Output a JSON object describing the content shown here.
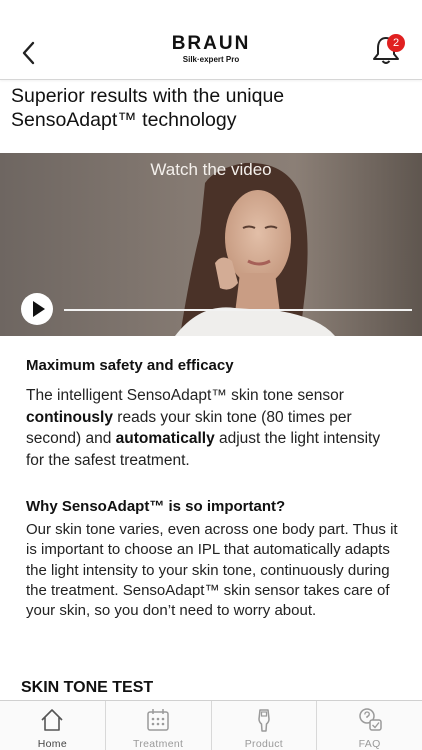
{
  "header": {
    "brand_name": "BRAUN",
    "brand_sub": "Silk·expert Pro",
    "notification_count": "2",
    "icons": {
      "back": "chevron-left-icon",
      "bell": "bell-icon"
    }
  },
  "page_title": "Superior results with the unique SensoAdapt™ technology",
  "video": {
    "label": "Watch the video",
    "progress": 0,
    "icons": {
      "play": "play-icon"
    }
  },
  "section1": {
    "title": "Maximum safety and efficacy",
    "p1": "The intelligent SensoAdapt™  skin tone sensor ",
    "b1": "continously",
    "p2": " reads your skin tone (80 times per second) and ",
    "b2": "automatically",
    "p3": " adjust the light intensity for the safest treatment."
  },
  "section2": {
    "title": "Why SensoAdapt™ is so important?",
    "text": "Our skin tone varies, even across one body part. Thus it is important to choose an IPL that automatically adapts the light intensity to your skin tone, continuously during the treatment. SensoAdapt™ skin sensor takes care of your skin, so you don’t need to worry about."
  },
  "skin_tone_title": "SKIN TONE TEST",
  "nav": {
    "items": [
      {
        "label": "Home",
        "icon": "home-icon",
        "active": true
      },
      {
        "label": "Treatment",
        "icon": "calendar-icon",
        "active": false
      },
      {
        "label": "Product",
        "icon": "device-icon",
        "active": false
      },
      {
        "label": "FAQ",
        "icon": "faq-icon",
        "active": false
      }
    ]
  },
  "colors": {
    "badge": "#e02020",
    "text": "#111111",
    "nav_inactive": "#9a9a9a"
  }
}
